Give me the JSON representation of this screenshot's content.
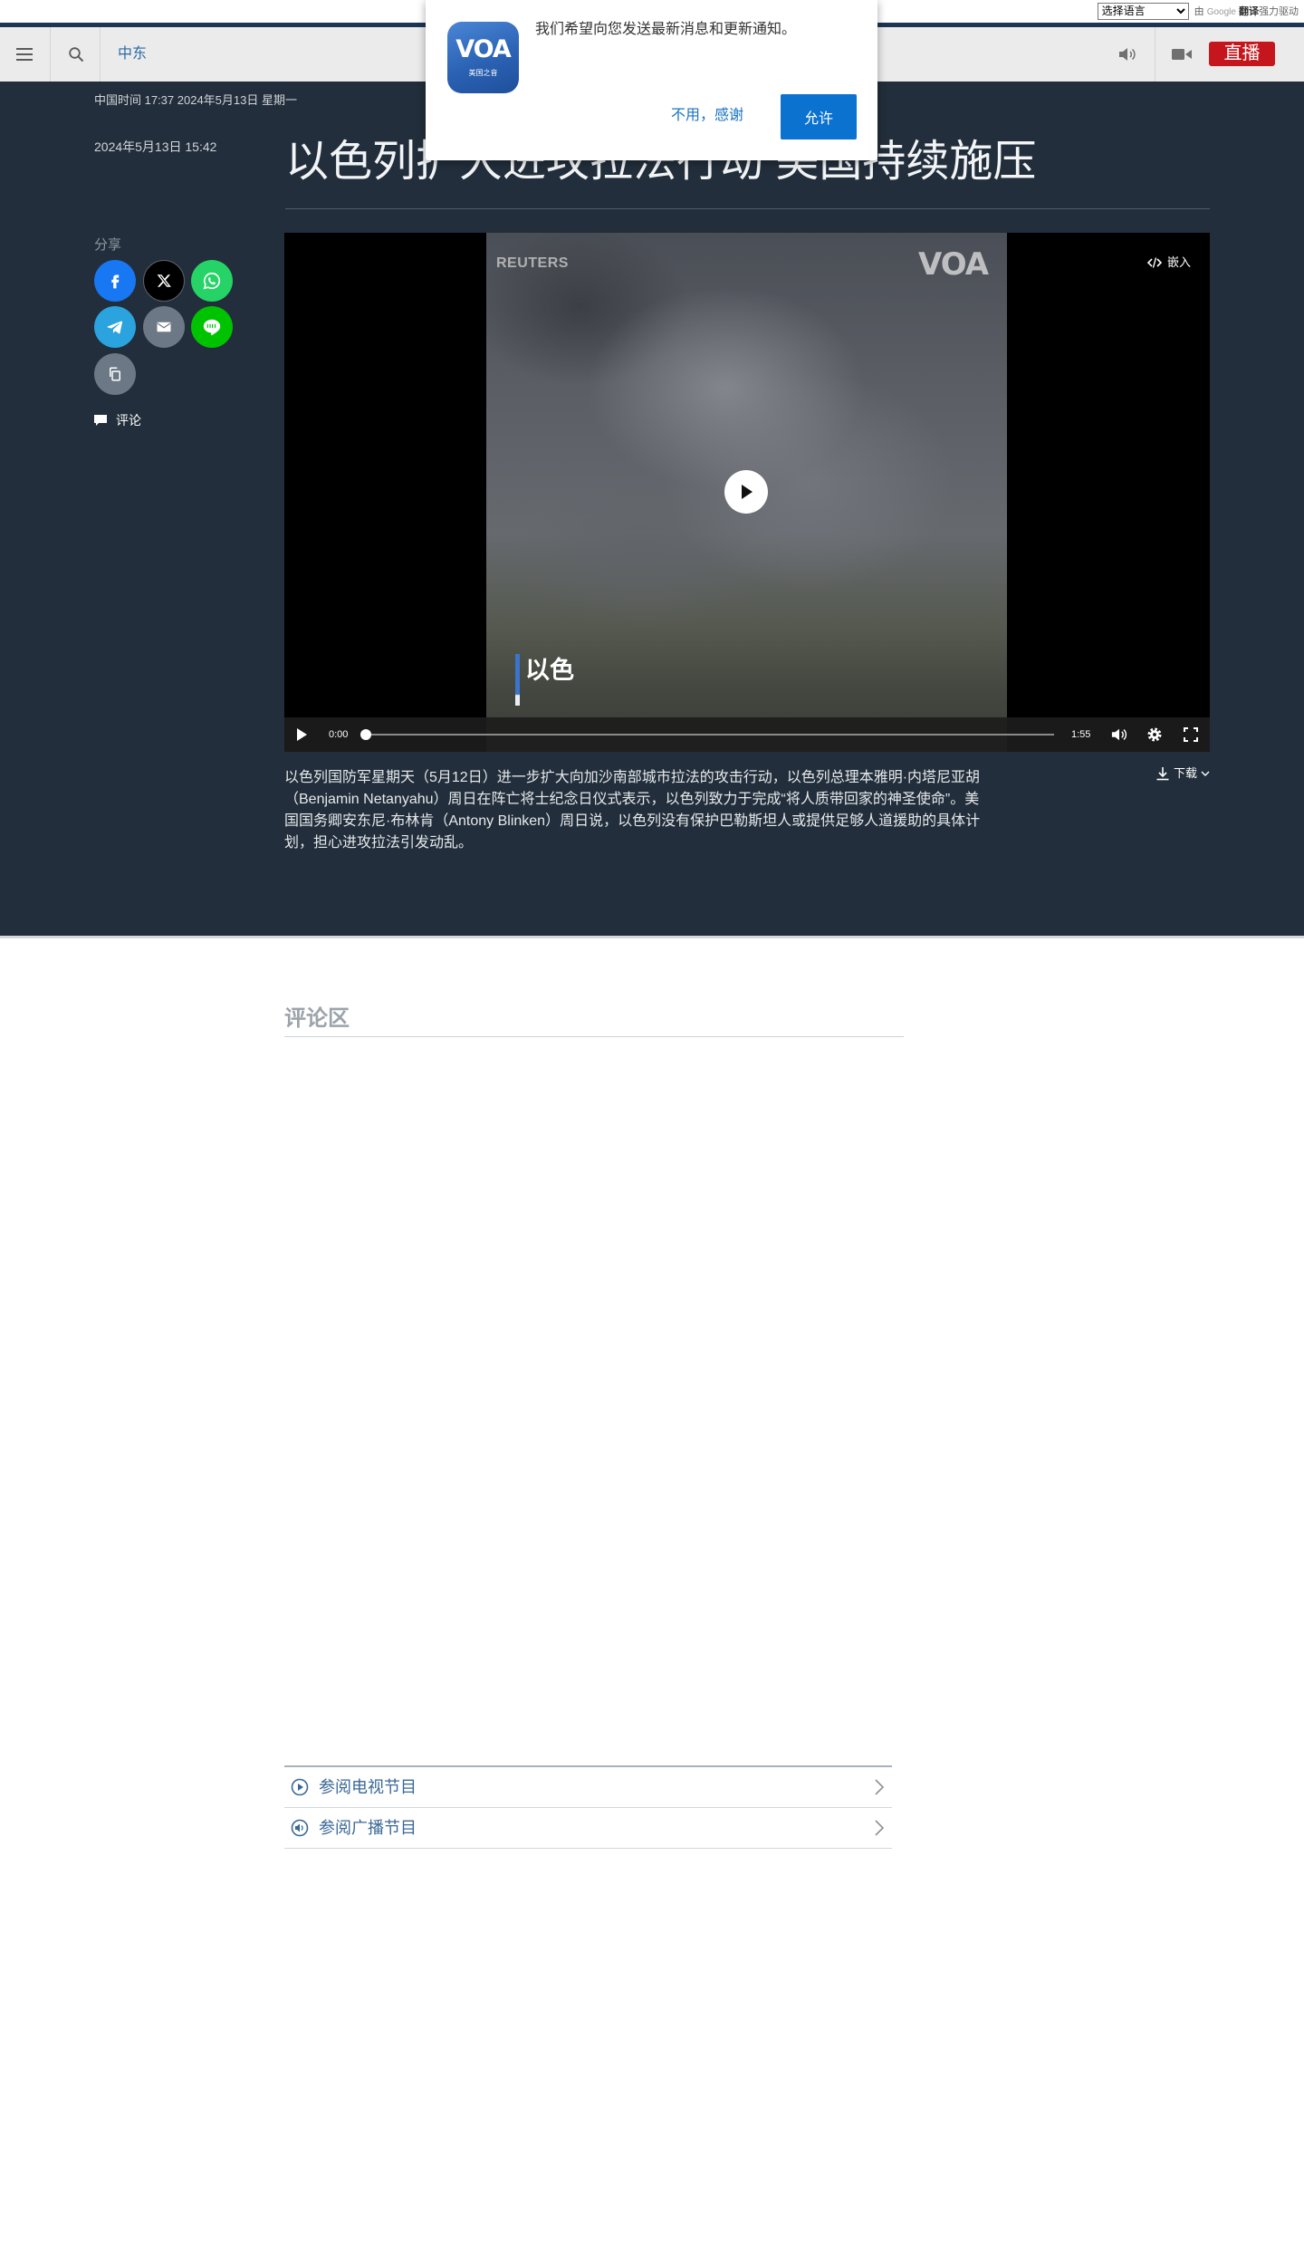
{
  "translate_widget": {
    "language_select": "选择语言",
    "powered_by": "由",
    "brand": "Google",
    "product": "翻译",
    "suffix": "强力驱动"
  },
  "header": {
    "menu_icon": "hamburger-menu-icon",
    "search_icon": "search-icon",
    "section": "中东",
    "audio_icon": "speaker-icon",
    "video_icon": "video-camera-icon",
    "live_label": "直播"
  },
  "colors": {
    "top_strip": "#1c3553",
    "header_bg": "#ebebeb",
    "page_dark_bg": "#222e3b",
    "live_red": "#c4161c",
    "link_blue": "#2b6aa7",
    "allow_blue": "#0b72d0",
    "caption_bar_blue": "#3b74c9"
  },
  "article": {
    "china_time": "中国时间 17:37 2024年5月13日 星期一",
    "published": "2024年5月13日 15:42",
    "title": "以色列扩大进攻拉法行动 美国持续施压",
    "share_label": "分享",
    "share_buttons": [
      {
        "icon": "facebook-icon",
        "color": "#1877f2"
      },
      {
        "icon": "x-icon",
        "color": "#000000"
      },
      {
        "icon": "whatsapp-icon",
        "color": "#25d366"
      },
      {
        "icon": "telegram-icon",
        "color": "#2aa3df"
      },
      {
        "icon": "email-icon",
        "color": "#6c7886"
      },
      {
        "icon": "line-icon",
        "color": "#00c300"
      },
      {
        "icon": "copy-link-icon",
        "color": "#6c7886"
      }
    ],
    "comment_label": "评论",
    "download_label": "下载",
    "summary": "以色列国防军星期天（5月12日）进一步扩大向加沙南部城市拉法的攻击行动，以色列总理本雅明·内塔尼亚胡（Benjamin Netanyahu）周日在阵亡将士纪念日仪式表示，以色列致力于完成“将人质带回家的神圣使命”。美国国务卿安东尼·布林肯（Antony Blinken）周日说，以色列没有保护巴勒斯坦人或提供足够人道援助的具体计划，担心进攻拉法引发动乱。"
  },
  "video": {
    "watermark": "REUTERS",
    "logo": "VOA",
    "embed_label": "嵌入",
    "caption": "以色",
    "current_time": "0:00",
    "duration": "1:55",
    "progress": 0
  },
  "comments": {
    "heading": "评论区"
  },
  "program_links": [
    {
      "label": "参阅电视节目",
      "icon": "play-circle-icon"
    },
    {
      "label": "参阅广播节目",
      "icon": "speaker-circle-icon"
    }
  ],
  "notification": {
    "app_icon_logo": "VOA",
    "app_icon_subtitle": "美国之音",
    "message": "我们希望向您发送最新消息和更新通知。",
    "decline_label": "不用，感谢",
    "allow_label": "允许"
  }
}
